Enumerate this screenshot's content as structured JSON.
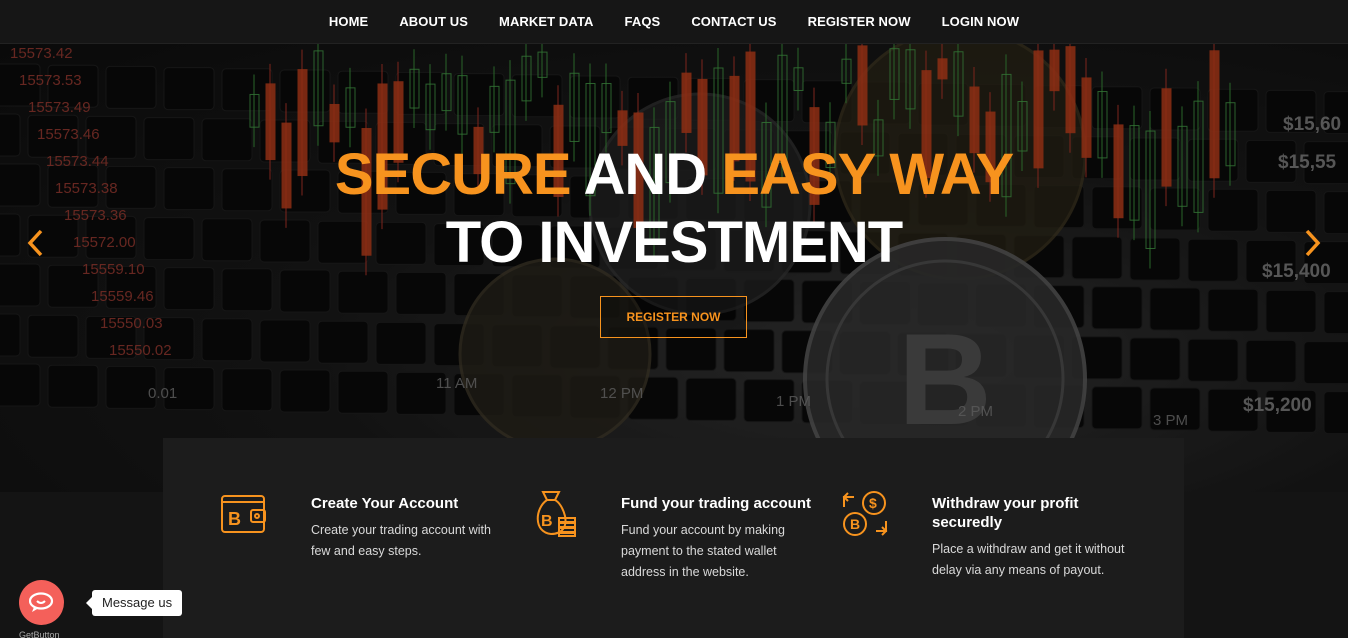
{
  "nav": {
    "items": [
      "HOME",
      "ABOUT US",
      "MARKET DATA",
      "FAQS",
      "CONTACT US",
      "REGISTER NOW",
      "LOGIN NOW"
    ]
  },
  "hero": {
    "line1_part1": "SECURE",
    "line1_part2": "AND",
    "line1_part3": "EASY WAY",
    "line2": "TO INVESTMENT",
    "button": "REGISTER NOW",
    "bg_prices_left": [
      "15573.42",
      "15573.53",
      "15573.49",
      "15573.46",
      "15573.44",
      "15573.38",
      "15573.36",
      "15572.00",
      "15559.10",
      "15559.46",
      "15550.03",
      "15550.02"
    ],
    "bg_prices_right": [
      "$15,60",
      "$15,55",
      "$15,400",
      "$15,200"
    ],
    "bg_times": [
      "11 AM",
      "12 PM",
      "1 PM",
      "2 PM",
      "3 PM",
      "0.01"
    ]
  },
  "features": [
    {
      "icon": "wallet-bitcoin-icon",
      "title": "Create Your Account",
      "desc_lines": [
        "Create your trading account with",
        "few and easy steps."
      ]
    },
    {
      "icon": "money-bag-bitcoin-icon",
      "title": "Fund your trading account",
      "desc_lines": [
        "Fund your account by making",
        "payment to the stated wallet",
        "address in the website."
      ]
    },
    {
      "icon": "exchange-bitcoin-dollar-icon",
      "title_lines": [
        "Withdraw your profit",
        "securedly"
      ],
      "desc_lines": [
        "Place a withdraw and get it without",
        "delay via any means of payout."
      ]
    }
  ],
  "widget": {
    "label": "Message us",
    "brand": "GetButton"
  },
  "colors": {
    "accent": "#f7931e",
    "background": "#141414",
    "panel": "#1c1c1c",
    "widget": "#f4605a"
  }
}
